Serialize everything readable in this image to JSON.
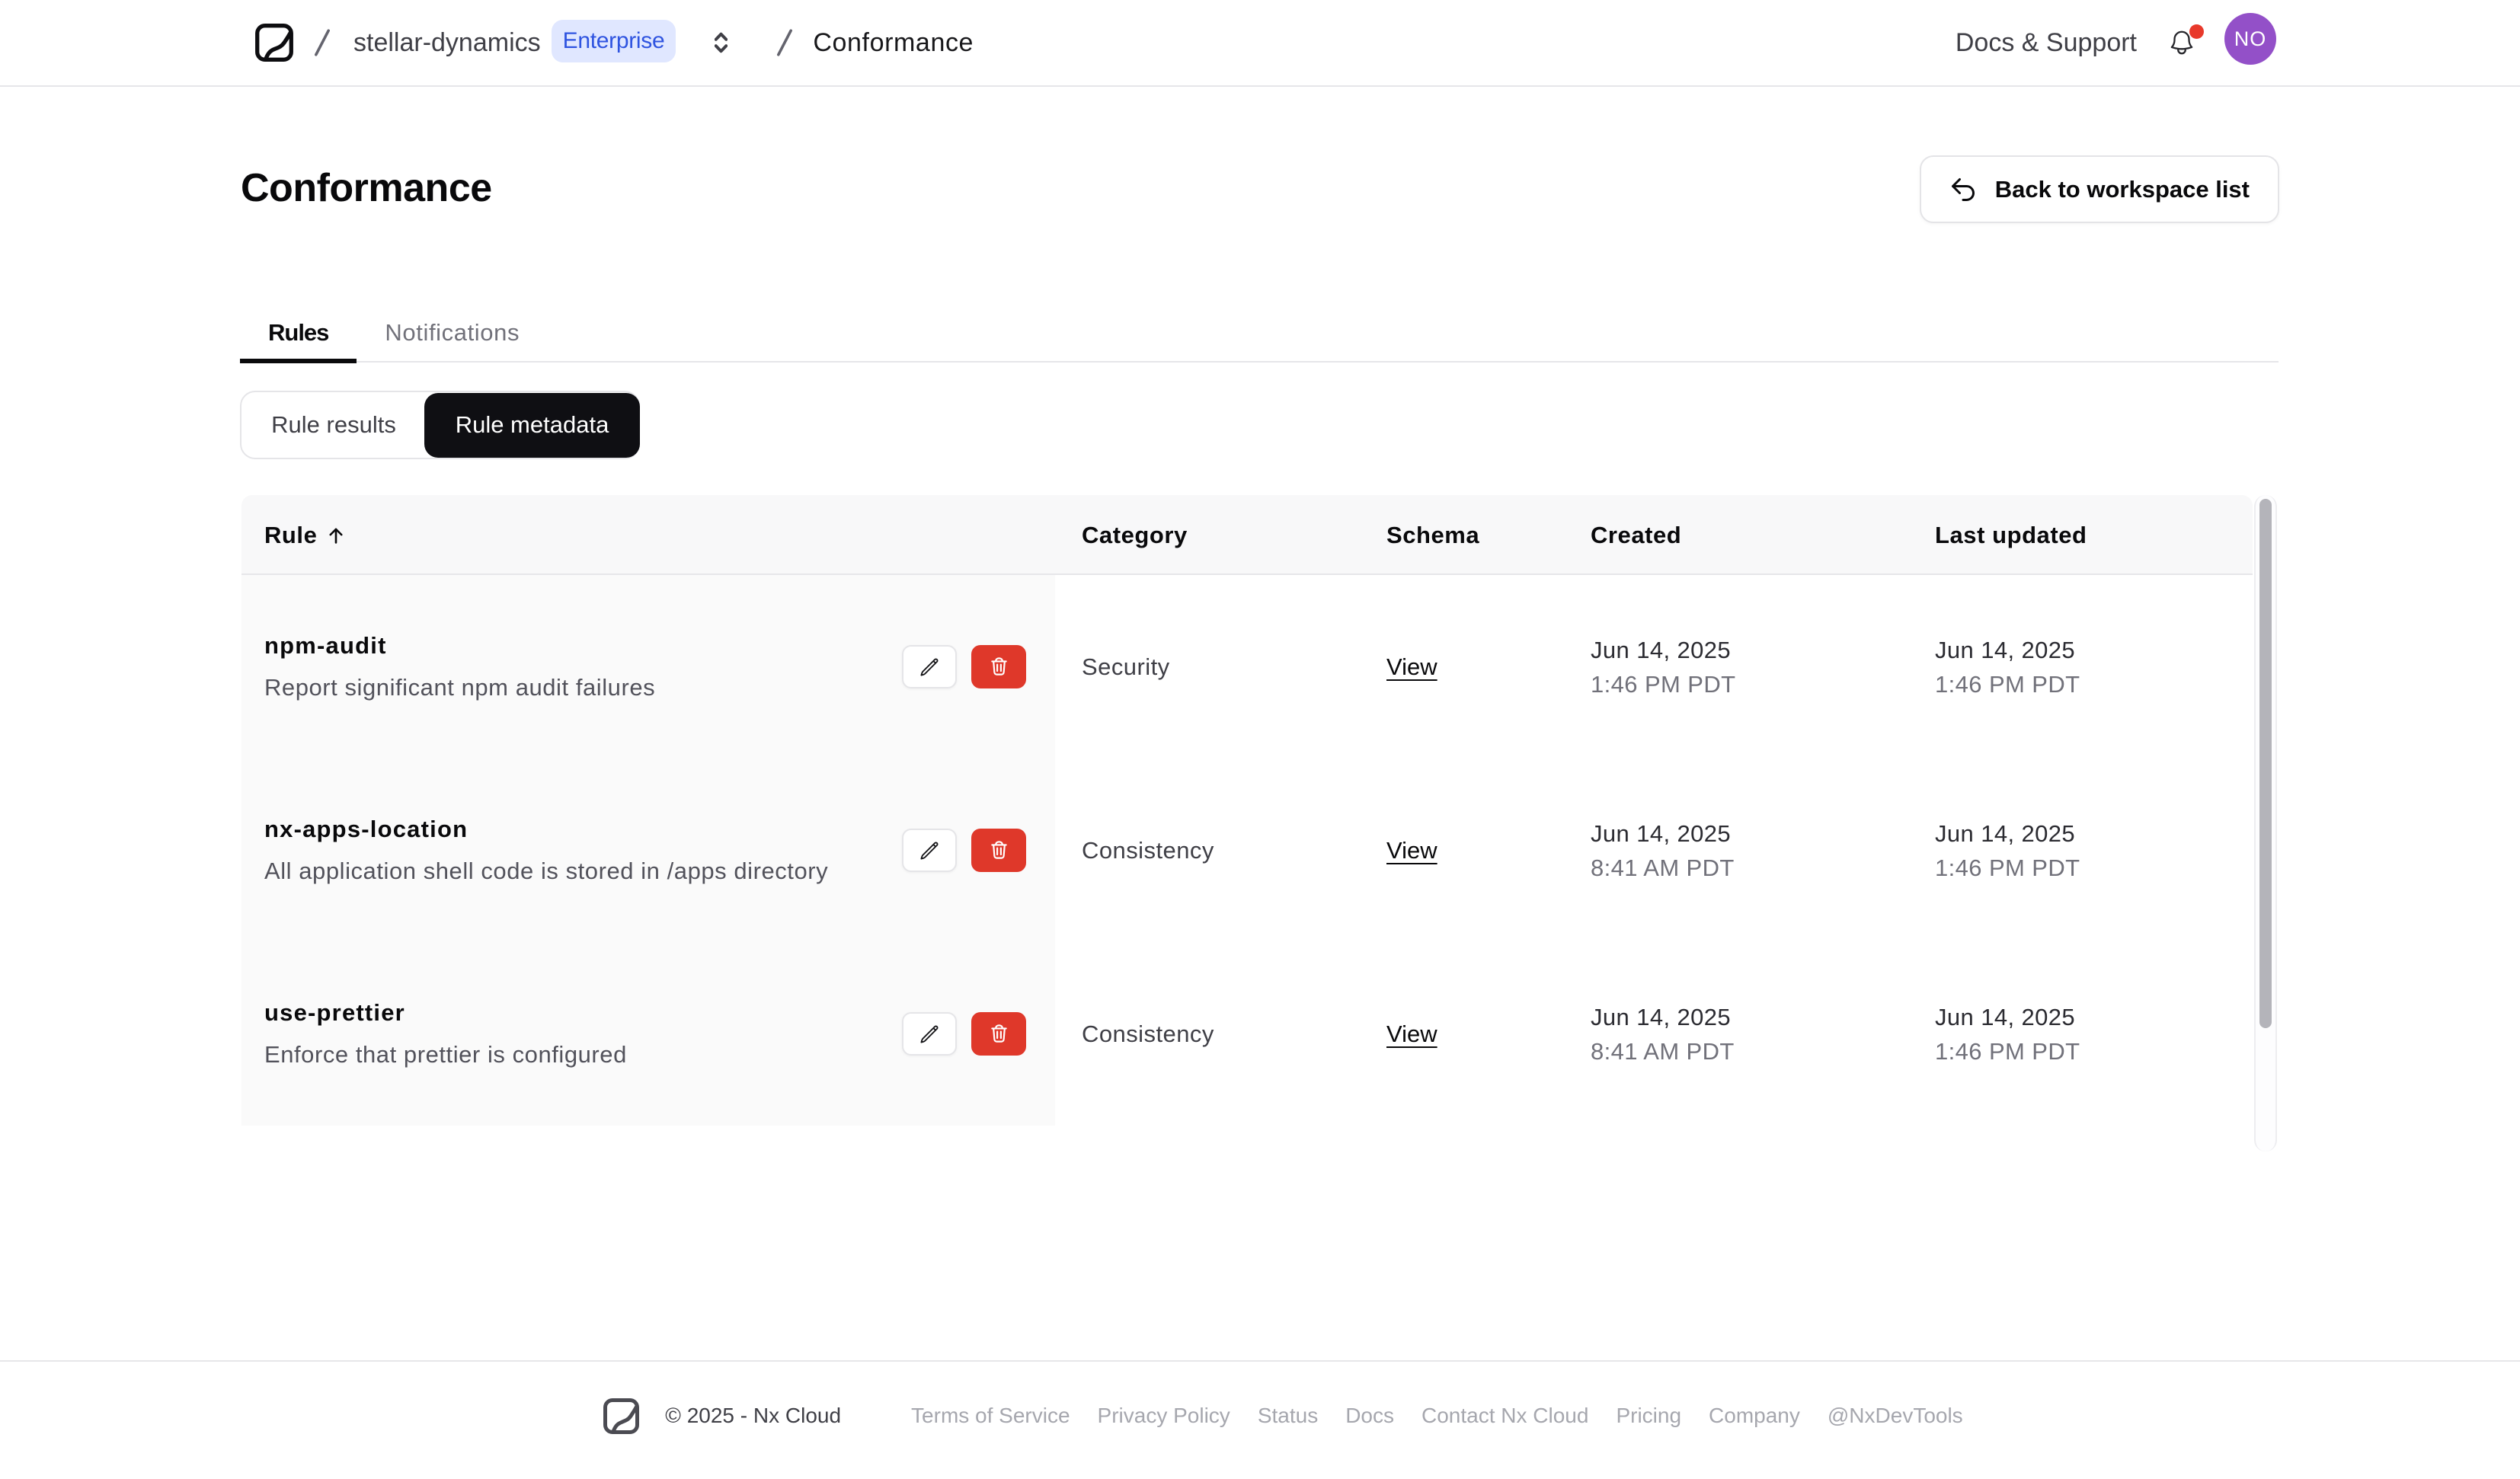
{
  "colors": {
    "badge_bg": "#e0e7ff",
    "badge_text": "#2f54e0",
    "avatar_bg": "#9350c8",
    "notification_dot": "#e8392b",
    "danger": "#df382a",
    "active_pill": "#0f0f13"
  },
  "nav": {
    "logo": "nx-cloud-logo",
    "breadcrumb": {
      "workspace": "stellar-dynamics",
      "badge": "Enterprise",
      "page": "Conformance"
    },
    "docs_support": "Docs & Support",
    "avatar_initials": "NO"
  },
  "page": {
    "title": "Conformance",
    "back_button": "Back to workspace list"
  },
  "tabs": [
    {
      "label": "Rules",
      "active": true
    },
    {
      "label": "Notifications",
      "active": false
    }
  ],
  "view_toggle": [
    {
      "label": "Rule results",
      "active": false
    },
    {
      "label": "Rule metadata",
      "active": true
    }
  ],
  "table": {
    "columns": {
      "rule": "Rule",
      "category": "Category",
      "schema": "Schema",
      "created": "Created",
      "updated": "Last updated"
    },
    "sort": {
      "column": "Rule",
      "direction": "ascending"
    },
    "rows": [
      {
        "name": "npm-audit",
        "description": "Report significant npm audit failures",
        "category": "Security",
        "schema_link": "View",
        "created_date": "Jun 14, 2025",
        "created_time": "1:46 PM PDT",
        "updated_date": "Jun 14, 2025",
        "updated_time": "1:46 PM PDT"
      },
      {
        "name": "nx-apps-location",
        "description": "All application shell code is stored in /apps directory",
        "category": "Consistency",
        "schema_link": "View",
        "created_date": "Jun 14, 2025",
        "created_time": "8:41 AM PDT",
        "updated_date": "Jun 14, 2025",
        "updated_time": "1:46 PM PDT"
      },
      {
        "name": "use-prettier",
        "description": "Enforce that prettier is configured",
        "category": "Consistency",
        "schema_link": "View",
        "created_date": "Jun 14, 2025",
        "created_time": "8:41 AM PDT",
        "updated_date": "Jun 14, 2025",
        "updated_time": "1:46 PM PDT"
      }
    ]
  },
  "footer": {
    "copyright": "© 2025 - Nx Cloud",
    "links": [
      "Terms of Service",
      "Privacy Policy",
      "Status",
      "Docs",
      "Contact Nx Cloud",
      "Pricing",
      "Company",
      "@NxDevTools"
    ]
  }
}
